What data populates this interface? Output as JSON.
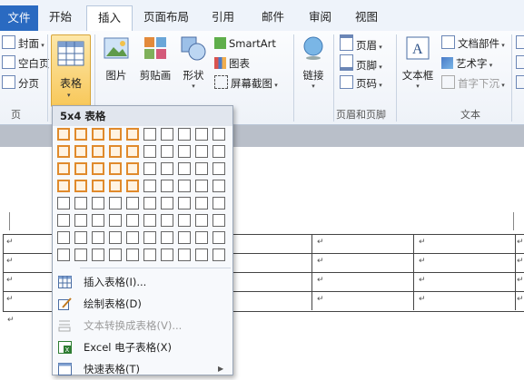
{
  "tabs": [
    "文件",
    "开始",
    "插入",
    "页面布局",
    "引用",
    "邮件",
    "审阅",
    "视图"
  ],
  "ribbon": {
    "pages": {
      "items": [
        "封面",
        "空白页",
        "分页"
      ],
      "label": "页"
    },
    "table_button": "表格",
    "illustrations": {
      "picture": "图片",
      "clipart": "剪贴画",
      "shapes": "形状",
      "smartart": "SmartArt",
      "chart": "图表",
      "screenshot": "屏幕截图"
    },
    "links": {
      "label": "链接"
    },
    "header_footer": {
      "items": [
        "页眉",
        "页脚",
        "页码"
      ],
      "label": "页眉和页脚"
    },
    "text": {
      "textbox": "文本框",
      "parts": "文档部件",
      "wordart": "艺术字",
      "dropcap": "首字下沉",
      "label": "文本"
    }
  },
  "dropdown": {
    "title": "5x4 表格",
    "grid": {
      "cols": 10,
      "rows": 8,
      "sel_cols": 5,
      "sel_rows": 4
    },
    "items": [
      {
        "label": "插入表格(I)...",
        "icon": "insert-table-icon",
        "disabled": false
      },
      {
        "label": "绘制表格(D)",
        "icon": "draw-table-icon",
        "disabled": false
      },
      {
        "label": "文本转换成表格(V)...",
        "icon": "convert-text-icon",
        "disabled": true
      },
      {
        "label": "Excel 电子表格(X)",
        "icon": "excel-icon",
        "disabled": false
      },
      {
        "label": "快速表格(T)",
        "icon": "quick-table-icon",
        "disabled": false
      }
    ]
  },
  "colors": {
    "file_tab": "#2a6ac1",
    "highlight": "#e08a2c",
    "table_button": "#f8c85a"
  },
  "doc": {
    "para_mark": "↵"
  }
}
